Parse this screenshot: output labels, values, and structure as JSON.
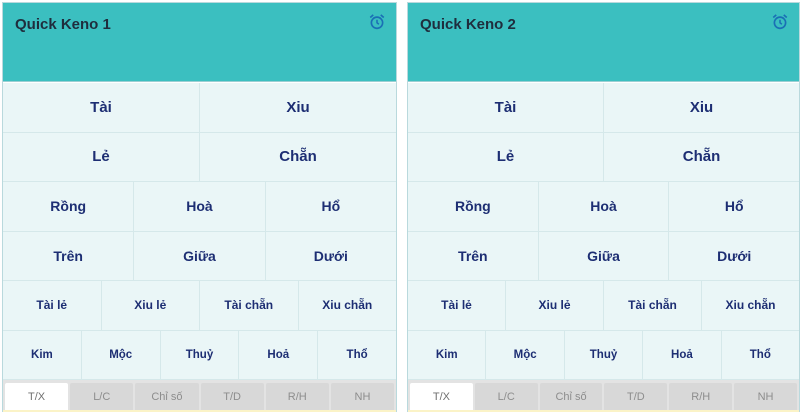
{
  "boards": [
    {
      "title": "Quick Keno 1",
      "icon": "alarm-clock-icon",
      "rows": [
        [
          "Tài",
          "Xiu"
        ],
        [
          "Lẻ",
          "Chẵn"
        ],
        [
          "Rồng",
          "Hoà",
          "Hổ"
        ],
        [
          "Trên",
          "Giữa",
          "Dưới"
        ],
        [
          "Tài lẻ",
          "Xiu lẻ",
          "Tài chẵn",
          "Xiu chẵn"
        ],
        [
          "Kim",
          "Mộc",
          "Thuỷ",
          "Hoả",
          "Thổ"
        ]
      ],
      "tabs": [
        "T/X",
        "L/C",
        "Chỉ số",
        "T/D",
        "R/H",
        "NH"
      ],
      "active_tab": "T/X"
    },
    {
      "title": "Quick Keno 2",
      "icon": "alarm-clock-icon",
      "rows": [
        [
          "Tài",
          "Xiu"
        ],
        [
          "Lẻ",
          "Chẵn"
        ],
        [
          "Rồng",
          "Hoà",
          "Hổ"
        ],
        [
          "Trên",
          "Giữa",
          "Dưới"
        ],
        [
          "Tài lẻ",
          "Xiu lẻ",
          "Tài chẵn",
          "Xiu chẵn"
        ],
        [
          "Kim",
          "Mộc",
          "Thuỷ",
          "Hoả",
          "Thổ"
        ]
      ],
      "tabs": [
        "T/X",
        "L/C",
        "Chỉ số",
        "T/D",
        "R/H",
        "NH"
      ],
      "active_tab": "T/X"
    }
  ],
  "colors": {
    "header": "#3bbfc0",
    "cell_bg": "#eaf6f7",
    "cell_text": "#1d2e73",
    "icon": "#1a6fb5"
  }
}
